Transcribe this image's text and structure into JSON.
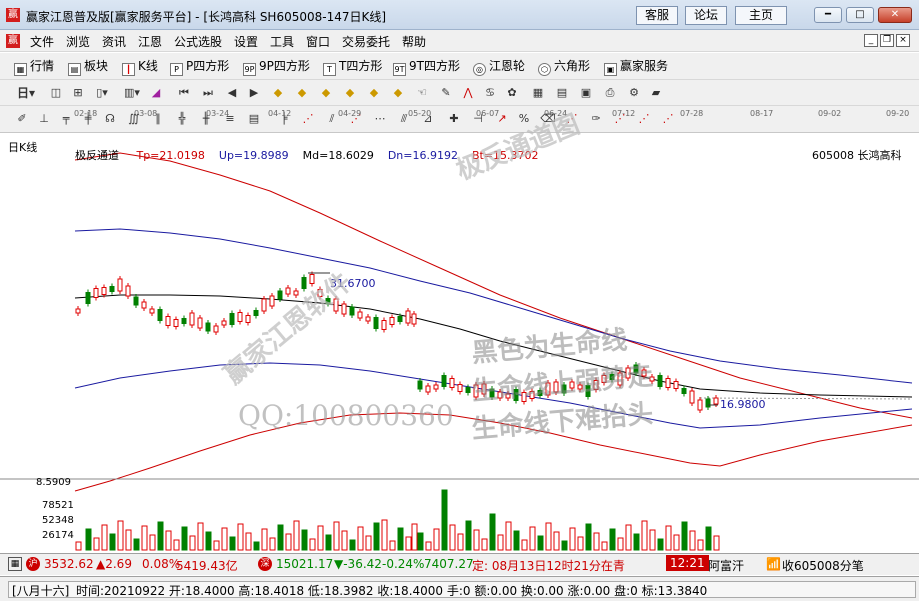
{
  "window": {
    "title": "赢家江恩普及版[赢家服务平台] - [长鸿高科  SH605008-147日K线]",
    "icon_text": "赢",
    "buttons": [
      "客服",
      "论坛",
      "主页"
    ]
  },
  "menu": [
    "文件",
    "浏览",
    "资讯",
    "江恩",
    "公式选股",
    "设置",
    "工具",
    "窗口",
    "交易委托",
    "帮助"
  ],
  "toolbar1": [
    "行情",
    "板块",
    "K线",
    "P四方形",
    "9P四方形",
    "T四方形",
    "9T四方形",
    "江恩轮",
    "六角形",
    "赢家服务"
  ],
  "toolbar2": {
    "period": "日"
  },
  "chart": {
    "period_label": "日K线",
    "indicator": "极反通道",
    "tp": "Tp=21.0198",
    "up": "Up=19.8989",
    "md": "Md=18.6029",
    "dn": "Dn=16.9192",
    "bt": "Bt=15.3702",
    "stock": "605008 长鸿高科",
    "high_mark": "31.6700",
    "low_mark": "16.9800",
    "date_ticks": [
      "02-18",
      "03-08",
      "03-24",
      "04-12",
      "04-29",
      "05-20",
      "06-07",
      "06-24",
      "07-12",
      "07-28",
      "08-17",
      "09-02",
      "09-20"
    ],
    "vol_axis": [
      "8.5909",
      "78521",
      "52348",
      "26174"
    ],
    "watermarks": [
      "极反通道图",
      "赢家江恩软件",
      "黑色为生命线",
      "生命线上强势走",
      "生命线下难抬头",
      "QQ:100800360"
    ]
  },
  "status1": {
    "sh": "3532.62",
    "sh_chg": "▲2.69",
    "sh_pct": "0.08%",
    "sh_amt": "5419.43亿",
    "sz": "15021.17",
    "sz_chg": "▼-36.42",
    "sz_pct": "-0.24%",
    "sz_amt": "7407.27",
    "notice": "定: 08月13日12时21分在青",
    "time": "12:21",
    "user": "阿富汗",
    "recv": "收605008分笔"
  },
  "status2": {
    "lunar": "[八月十六]",
    "detail": "时间:20210922 开:18.4000 高:18.4018 低:18.3982 收:18.4000 手:0 额:0.00 换:0.00 涨:0.00 盘:0 标:13.3840"
  },
  "colors": {
    "up": "#e00000",
    "down": "#008000",
    "redline": "#cc0000",
    "blueline": "#1a1aa0",
    "midline": "#000000"
  }
}
